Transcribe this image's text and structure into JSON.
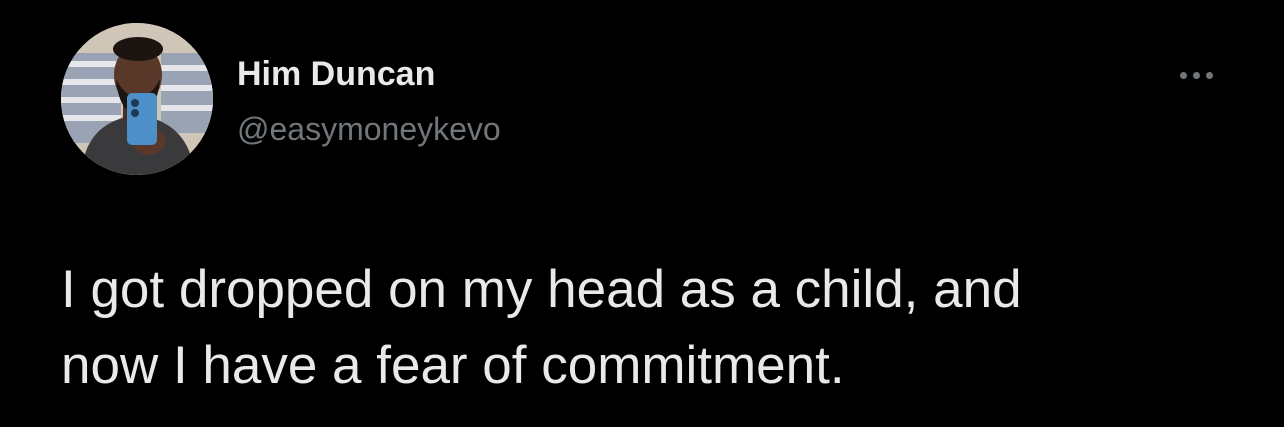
{
  "author": {
    "display_name": "Him Duncan",
    "handle": "@easymoneykevo",
    "avatar_icon": "profile-photo"
  },
  "actions": {
    "more_icon": "more-horizontal-icon"
  },
  "tweet": {
    "line1": "I got dropped on my head as a child, and",
    "line2": "now I have a fear of commitment."
  },
  "colors": {
    "background": "#000000",
    "primary_text": "#e7e9ea",
    "secondary_text": "#71767b"
  }
}
